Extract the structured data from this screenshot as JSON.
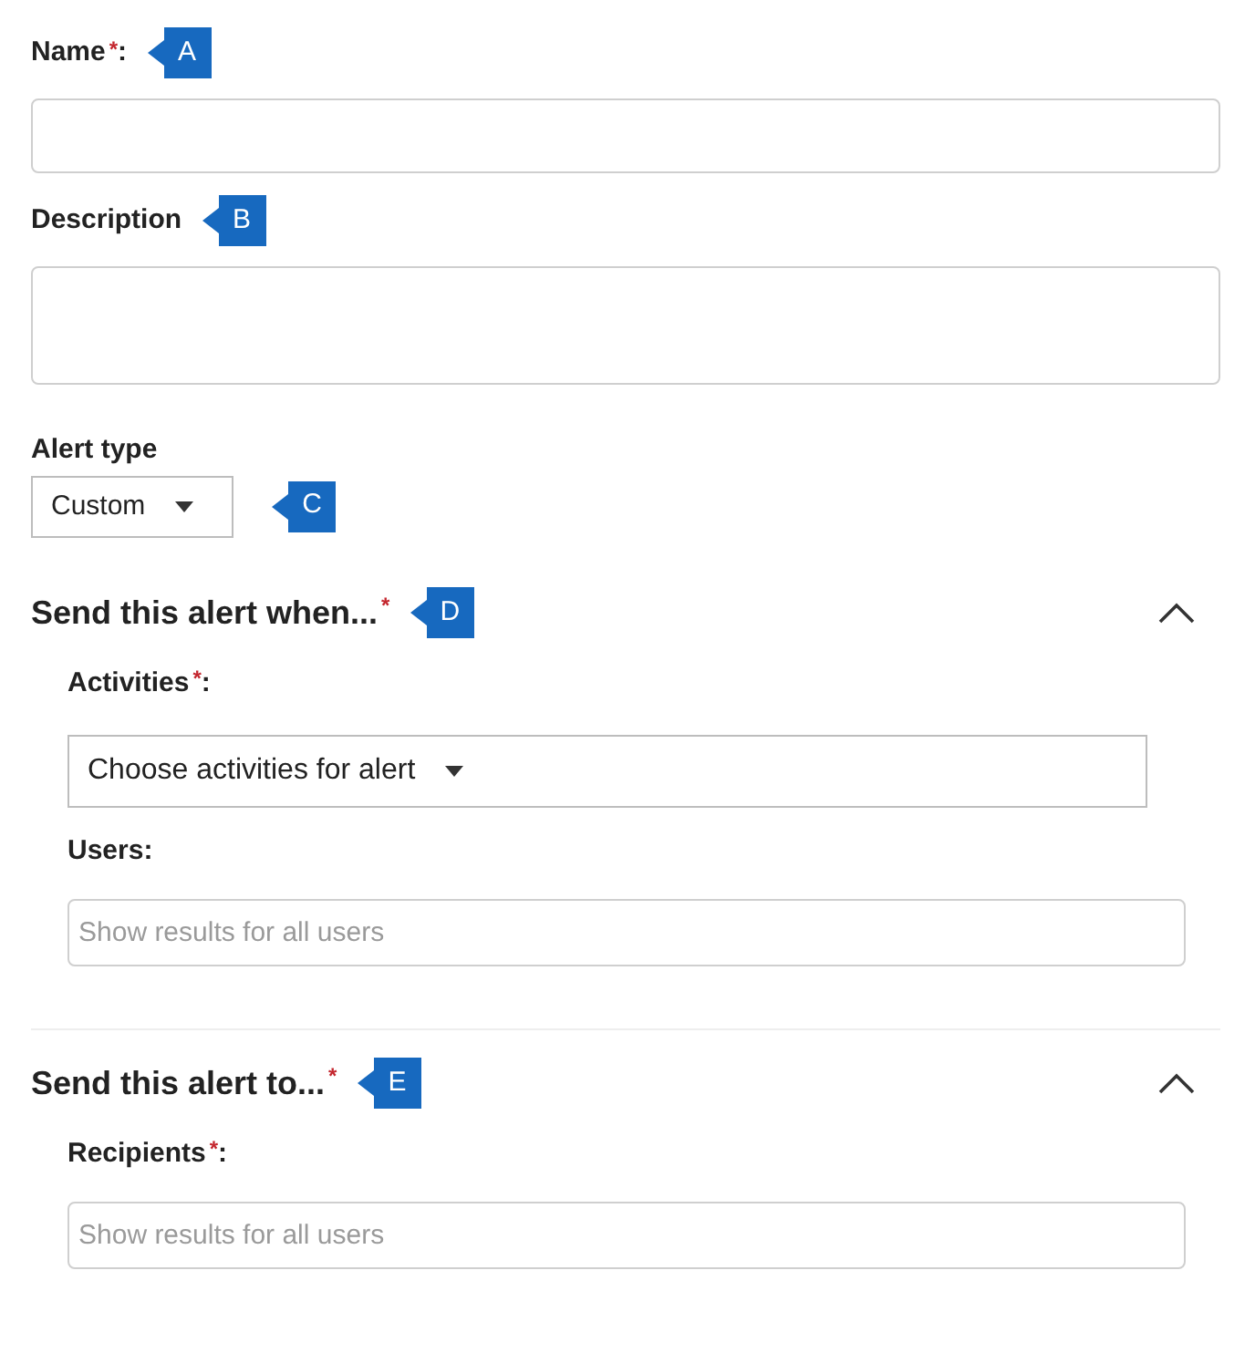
{
  "name": {
    "label": "Name",
    "asterisk": "*",
    "after": ":",
    "callout": "A"
  },
  "description": {
    "label": "Description",
    "callout": "B"
  },
  "alert_type": {
    "label": "Alert type",
    "value": "Custom",
    "callout": "C"
  },
  "sections": [
    {
      "title": "Send this alert when...",
      "asterisk": "*",
      "callout": "D",
      "expanded": true,
      "fields": [
        {
          "kind": "dropdown",
          "label": "Activities",
          "asterisk": "*",
          "after": ":",
          "value": "Choose activities for alert"
        },
        {
          "kind": "search",
          "label": "Users",
          "after": ":",
          "placeholder": "Show results for all users"
        }
      ]
    },
    {
      "title": "Send this alert to...",
      "asterisk": "*",
      "callout": "E",
      "expanded": true,
      "fields": [
        {
          "kind": "search",
          "label": "Recipients",
          "asterisk": "*",
          "after": ":",
          "placeholder": "Show results for all users"
        }
      ]
    }
  ]
}
